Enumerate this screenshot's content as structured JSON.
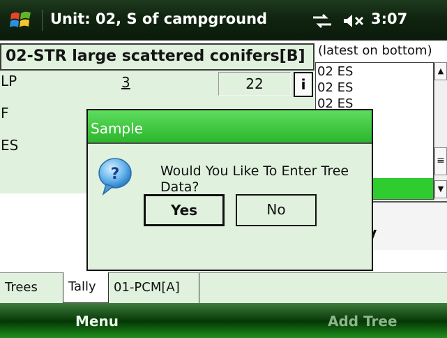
{
  "titlebar": {
    "title": "Unit: 02, S of campground",
    "time": "3:07",
    "icons": [
      "windows-start-icon",
      "connectivity-icon",
      "speaker-muted-icon"
    ]
  },
  "main": {
    "stratum_label": "02-STR large scattered conifers[B]",
    "rows": [
      {
        "species": "LP",
        "tree_count": "3",
        "plot_count": "22",
        "info": "i"
      },
      {
        "species": "F"
      },
      {
        "species": "ES"
      }
    ],
    "log": {
      "header": "(latest on bottom)",
      "items": [
        "02 ES",
        "02 ES",
        "02 ES"
      ]
    },
    "tally_button": "Tally"
  },
  "tabs": [
    {
      "label": "Trees",
      "active": false
    },
    {
      "label": "Tally",
      "active": true
    },
    {
      "label": "01-PCM[A]",
      "active": false
    }
  ],
  "softkeys": {
    "left": "Menu",
    "right": "Add Tree"
  },
  "dialog": {
    "title": "Sample",
    "message": "Would You Like To Enter Tree Data?",
    "yes_label": "Yes",
    "no_label": "No"
  },
  "colors": {
    "app_background": "#e0f1de",
    "accent_green": "#2ecc2e",
    "title_bar": "#102410"
  }
}
